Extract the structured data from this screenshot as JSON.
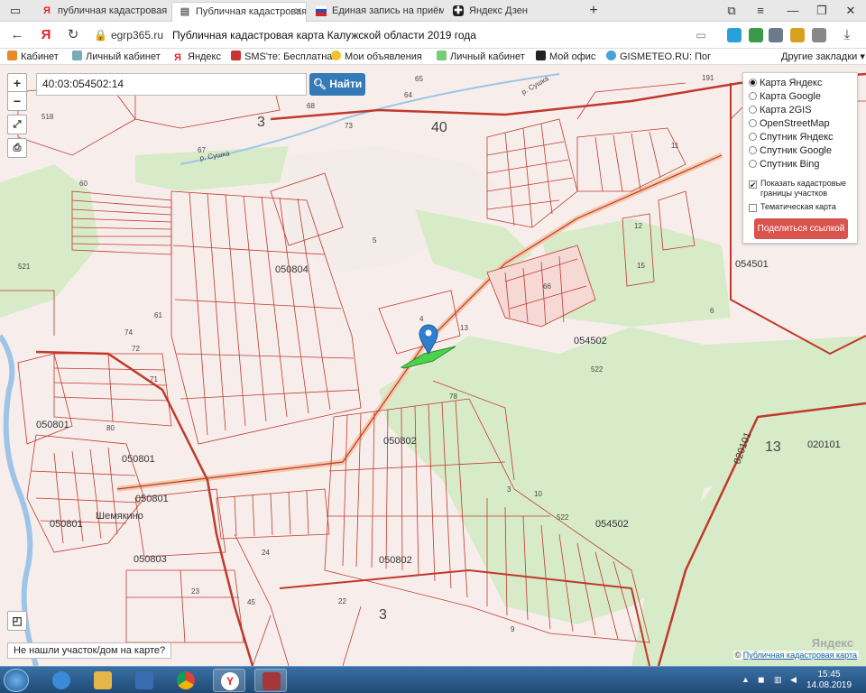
{
  "browser": {
    "tabs": [
      {
        "label": "публичная кадастровая к",
        "icon": "yandex-icon",
        "active": false
      },
      {
        "label": "Публичная кадастровая",
        "icon": "doc-icon",
        "active": true
      },
      {
        "label": "Единая запись на приём в",
        "icon": "flag-icon",
        "active": false
      },
      {
        "label": "Яндекс Дзен",
        "icon": "zen-icon",
        "active": false
      }
    ],
    "new_tab": "+",
    "url_domain": "egrp365.ru",
    "page_title": "Публичная кадастровая карта Калужской области 2019 года",
    "bookmarks": [
      "Кабинет",
      "Личный кабинет",
      "Яндекс",
      "SMS'те: Бесплатна",
      "Мои объявления",
      "Личный кабинет",
      "Мой офис",
      "GISMETEO.RU: Пог"
    ],
    "other_bookmarks": "Другие закладки"
  },
  "map": {
    "search_value": "40:03:054502:14",
    "find_label": "Найти",
    "zoom_in": "+",
    "zoom_out": "−",
    "layers": {
      "options": [
        "Карта Яндекс",
        "Карта Google",
        "Карта 2GIS",
        "OpenStreetMap",
        "Спутник Яндекс",
        "Спутник Google",
        "Спутник Bing"
      ],
      "selected": 0,
      "show_borders": "Показать кадастровые границы участков",
      "show_borders_checked": true,
      "thematic": "Тематическая карта",
      "thematic_checked": false,
      "share_label": "Поделиться ссылкой"
    },
    "not_found": "Не нашли участок/дом на карте?",
    "copyright_prefix": "©",
    "copyright_link": "Публичная кадастровая карта",
    "yandex_watermark": "Яндекс",
    "labels": {
      "quarter_40": "40",
      "q050804": "050804",
      "q054501": "054501",
      "q054502": "054502",
      "q054502b": "054502",
      "q050802": "050802",
      "q050802b": "050802",
      "q050801": "050801",
      "q050801b": "050801",
      "q050801c": "050801",
      "q050801d": "050801",
      "q050803": "050803",
      "q020101": "020101",
      "q020101b": "020101",
      "n521": "521",
      "n518": "518",
      "n522": "522",
      "n522b": "522",
      "n66": "66",
      "n13": "13",
      "n3": "3",
      "n3b": "3",
      "n5": "5",
      "n4": "4",
      "n13b": "13",
      "n78": "78",
      "n22": "22",
      "n24": "24",
      "n23": "23",
      "n45": "45",
      "river1": "р. Сушка",
      "river2": "р. Сушка",
      "village": "Шемякино",
      "n191": "191",
      "n73": "73",
      "n65": "65",
      "n64": "64",
      "n68": "68",
      "n67": "67",
      "n80": "80",
      "n74": "74",
      "n72": "72",
      "n71": "71",
      "n61": "61",
      "n60": "60",
      "n12": "12",
      "n15": "15",
      "n6": "6",
      "n11": "11",
      "n10": "10",
      "n3c": "3",
      "n9": "9"
    }
  },
  "taskbar": {
    "time": "15:45",
    "date": "14.08.2019"
  }
}
